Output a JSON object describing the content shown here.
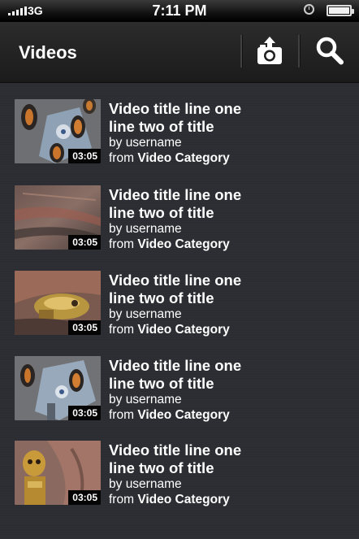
{
  "status_bar": {
    "carrier": "3G",
    "time": "7:11 PM"
  },
  "navbar": {
    "title": "Videos",
    "upload_icon": "camera-upload-icon",
    "search_icon": "search-icon"
  },
  "videos": [
    {
      "title_line1": "Video title line one",
      "title_line2": "line two of title",
      "by_prefix": "by",
      "username": "username",
      "from_prefix": "from",
      "category": "Video Category",
      "duration": "03:05"
    },
    {
      "title_line1": "Video title line one",
      "title_line2": "line two of title",
      "by_prefix": "by",
      "username": "username",
      "from_prefix": "from",
      "category": "Video Category",
      "duration": "03:05"
    },
    {
      "title_line1": "Video title line one",
      "title_line2": "line two of title",
      "by_prefix": "by",
      "username": "username",
      "from_prefix": "from",
      "category": "Video Category",
      "duration": "03:05"
    },
    {
      "title_line1": "Video title line one",
      "title_line2": "line two of title",
      "by_prefix": "by",
      "username": "username",
      "from_prefix": "from",
      "category": "Video Category",
      "duration": "03:05"
    },
    {
      "title_line1": "Video title line one",
      "title_line2": "line two of title",
      "by_prefix": "by",
      "username": "username",
      "from_prefix": "from",
      "category": "Video Category",
      "duration": "03:05"
    }
  ],
  "colors": {
    "background": "#2c2e33",
    "navbar": "#1f1f1f",
    "text": "#ffffff",
    "duration_badge": "#050505"
  }
}
